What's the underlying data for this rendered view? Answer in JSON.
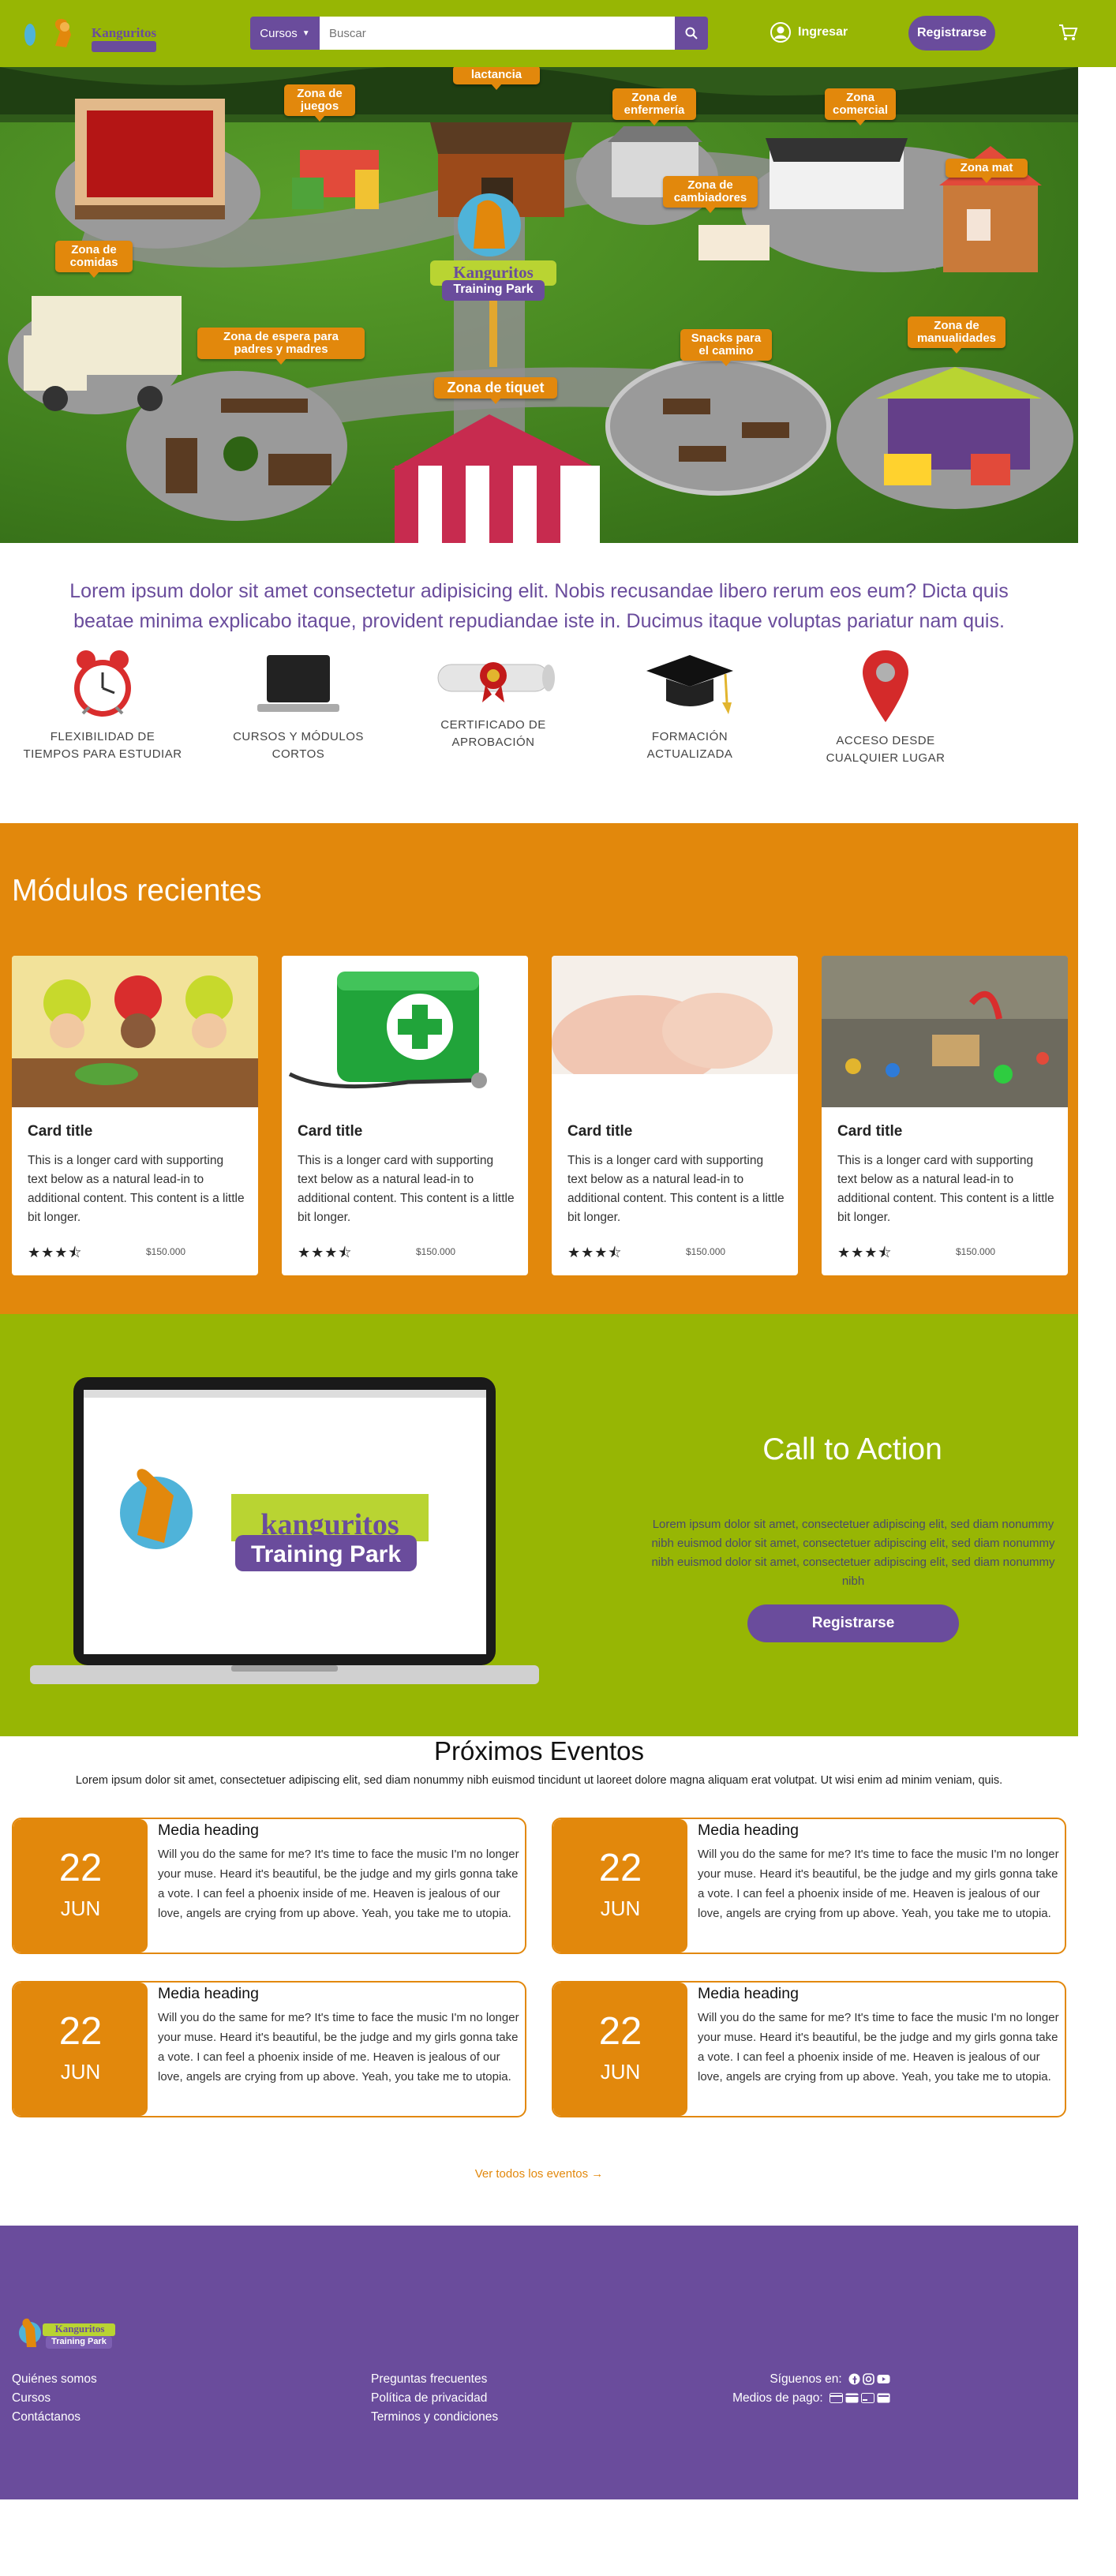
{
  "navbar": {
    "logo_text": "Kanguritos",
    "category_label": "Cursos",
    "search_placeholder": "Buscar",
    "login_label": "Ingresar",
    "register_label": "Registrarse"
  },
  "hero": {
    "park_logo_line1": "Kanguritos",
    "park_logo_line2": "Training Park",
    "zones": [
      {
        "label": "lactancia"
      },
      {
        "label": "Zona de juegos"
      },
      {
        "label": "Zona de enfermería"
      },
      {
        "label": "Zona comercial"
      },
      {
        "label": "Zona mat"
      },
      {
        "label": "Zona de cambiadores"
      },
      {
        "label": "Zona de comidas"
      },
      {
        "label": "Zona de espera para padres y madres"
      },
      {
        "label": "Zona de tiquet"
      },
      {
        "label": "Snacks para el camino"
      },
      {
        "label": "Zona de manualidades"
      }
    ]
  },
  "intro": {
    "text": "Lorem ipsum dolor sit amet consectetur adipisicing elit. Nobis recusandae libero rerum eos eum? Dicta quis beatae minima explicabo itaque, provident repudiandae iste in. Ducimus itaque voluptas pariatur nam quis."
  },
  "features": [
    {
      "icon": "alarm-clock-icon",
      "line1": "FLEXIBILIDAD DE",
      "line2": "TIEMPOS PARA ESTUDIAR"
    },
    {
      "icon": "laptop-icon",
      "line1": "CURSOS Y MÓDULOS",
      "line2": "CORTOS"
    },
    {
      "icon": "diploma-icon",
      "line1": "CERTIFICADO DE",
      "line2": "APROBACIÓN"
    },
    {
      "icon": "graduation-cap-icon",
      "line1": "FORMACIÓN",
      "line2": "ACTUALIZADA"
    },
    {
      "icon": "map-pin-icon",
      "line1": "ACCESO DESDE",
      "line2": "CUALQUIER LUGAR"
    }
  ],
  "modules": {
    "title": "Módulos recientes",
    "cards": [
      {
        "title": "Card title",
        "text": "This is a longer card with supporting text below as a natural lead-in to additional content. This content is a little bit longer.",
        "rating": 3.5,
        "price": "$150.000",
        "image": "kids-cooking-image"
      },
      {
        "title": "Card title",
        "text": "This is a longer card with supporting text below as a natural lead-in to additional content. This content is a little bit longer.",
        "rating": 3.5,
        "price": "$150.000",
        "image": "first-aid-kit-image"
      },
      {
        "title": "Card title",
        "text": "This is a longer card with supporting text below as a natural lead-in to additional content. This content is a little bit longer.",
        "rating": 3.5,
        "price": "$150.000",
        "image": "baby-hands-image"
      },
      {
        "title": "Card title",
        "text": "This is a longer card with supporting text below as a natural lead-in to additional content. This content is a little bit longer.",
        "rating": 3.5,
        "price": "$150.000",
        "image": "toys-image"
      }
    ]
  },
  "cta": {
    "title": "Call to Action",
    "text": "Lorem ipsum dolor sit amet, consectetuer adipiscing elit, sed diam nonummy nibh euismod dolor sit amet, consectetuer adipiscing elit, sed diam nonummy nibh euismod dolor sit amet, consectetuer adipiscing elit, sed diam nonummy nibh",
    "button_label": "Registrarse",
    "screen_logo_line1": "kanguritos",
    "screen_logo_line2": "Training Park"
  },
  "events": {
    "title": "Próximos Eventos",
    "subtitle": "Lorem ipsum dolor sit amet, consectetuer adipiscing elit, sed diam nonummy nibh euismod tincidunt ut laoreet dolore magna aliquam erat volutpat. Ut wisi enim ad minim veniam, quis.",
    "items": [
      {
        "day": "22",
        "month": "JUN",
        "heading": "Media heading",
        "text": "Will you do the same for me? It's time to face the music I'm no longer your muse. Heard it's beautiful, be the judge and my girls gonna take a vote. I can feel a phoenix inside of me. Heaven is jealous of our love, angels are crying from up above. Yeah, you take me to utopia."
      },
      {
        "day": "22",
        "month": "JUN",
        "heading": "Media heading",
        "text": "Will you do the same for me? It's time to face the music I'm no longer your muse. Heard it's beautiful, be the judge and my girls gonna take a vote. I can feel a phoenix inside of me. Heaven is jealous of our love, angels are crying from up above. Yeah, you take me to utopia."
      },
      {
        "day": "22",
        "month": "JUN",
        "heading": "Media heading",
        "text": "Will you do the same for me? It's time to face the music I'm no longer your muse. Heard it's beautiful, be the judge and my girls gonna take a vote. I can feel a phoenix inside of me. Heaven is jealous of our love, angels are crying from up above. Yeah, you take me to utopia."
      },
      {
        "day": "22",
        "month": "JUN",
        "heading": "Media heading",
        "text": "Will you do the same for me? It's time to face the music I'm no longer your muse. Heard it's beautiful, be the judge and my girls gonna take a vote. I can feel a phoenix inside of me. Heaven is jealous of our love, angels are crying from up above. Yeah, you take me to utopia."
      }
    ],
    "all_link": "Ver todos los eventos →"
  },
  "footer": {
    "logo_line1": "Kanguritos",
    "logo_line2": "Training Park",
    "col1": [
      "Quiénes somos",
      "Cursos",
      "Contáctanos"
    ],
    "col2": [
      "Preguntas frecuentes",
      "Política de privacidad",
      "Terminos y condiciones"
    ],
    "follow_label": "Síguenos en:",
    "payment_label": "Medios de pago:"
  },
  "colors": {
    "green": "#97b604",
    "orange": "#e2880c",
    "purple": "#6a4c9c"
  }
}
